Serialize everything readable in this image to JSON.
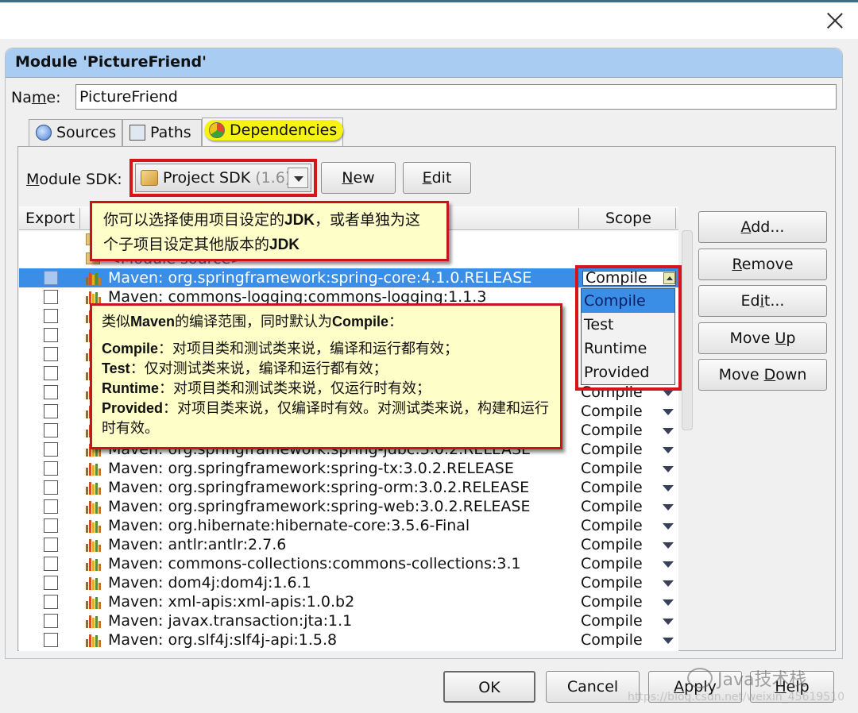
{
  "window": {
    "close_icon": "close-icon"
  },
  "panel": {
    "title": "Module 'PictureFriend'"
  },
  "name_field": {
    "label_pre": "Na",
    "label_u": "m",
    "label_post": "e:",
    "value": "PictureFriend"
  },
  "tabs": [
    {
      "label": "Sources",
      "icon": "sources-icon"
    },
    {
      "label": "Paths",
      "icon": "paths-icon"
    },
    {
      "label": "Dependencies",
      "icon": "dependencies-icon",
      "active": true
    }
  ],
  "sdk": {
    "label_u": "M",
    "label_rest": "odule SDK:",
    "selected": "Project SDK",
    "version": "(1.6)",
    "new_u": "N",
    "new_rest": "ew",
    "edit_u": "E",
    "edit_rest": "dit"
  },
  "table": {
    "headers": {
      "export": "Export",
      "scope": "Scope"
    },
    "rows": [
      {
        "type": "folder",
        "name": ""
      },
      {
        "type": "folder",
        "name": "<Module source>"
      },
      {
        "name": "Maven: org.springframework:spring-core:4.1.0.RELEASE",
        "scope": "Compile",
        "selected": true
      },
      {
        "name": "Maven: commons-logging:commons-logging:1.1.3",
        "scope": ""
      },
      {
        "name": "",
        "scope": ""
      },
      {
        "name": "",
        "scope": ""
      },
      {
        "name": "",
        "scope": ""
      },
      {
        "name": "",
        "scope": ""
      },
      {
        "name": "",
        "scope": "Compile"
      },
      {
        "name": "",
        "scope": "Compile"
      },
      {
        "name": "",
        "scope": "Compile"
      },
      {
        "name": "Maven: org.springframework:spring-jdbc:3.0.2.RELEASE",
        "scope": "Compile"
      },
      {
        "name": "Maven: org.springframework:spring-tx:3.0.2.RELEASE",
        "scope": "Compile"
      },
      {
        "name": "Maven: org.springframework:spring-orm:3.0.2.RELEASE",
        "scope": "Compile"
      },
      {
        "name": "Maven: org.springframework:spring-web:3.0.2.RELEASE",
        "scope": "Compile"
      },
      {
        "name": "Maven: org.hibernate:hibernate-core:3.5.6-Final",
        "scope": "Compile"
      },
      {
        "name": "Maven: antlr:antlr:2.7.6",
        "scope": "Compile"
      },
      {
        "name": "Maven: commons-collections:commons-collections:3.1",
        "scope": "Compile"
      },
      {
        "name": "Maven: dom4j:dom4j:1.6.1",
        "scope": "Compile"
      },
      {
        "name": "Maven: xml-apis:xml-apis:1.0.b2",
        "scope": "Compile"
      },
      {
        "name": "Maven: javax.transaction:jta:1.1",
        "scope": "Compile"
      },
      {
        "name": "Maven: org.slf4j:slf4j-api:1.5.8",
        "scope": "Compile"
      }
    ]
  },
  "scope_editor": {
    "value": "Compile",
    "options": [
      "Compile",
      "Test",
      "Runtime",
      "Provided"
    ],
    "highlighted": "Compile"
  },
  "side_buttons": {
    "add": {
      "u": "A",
      "rest": "dd..."
    },
    "remove": {
      "u": "R",
      "rest": "emove"
    },
    "edit": {
      "pre": "Ed",
      "u": "i",
      "rest": "t..."
    },
    "move_up": {
      "pre": "Move ",
      "u": "U",
      "rest": "p"
    },
    "move_down": {
      "pre": "Move ",
      "u": "D",
      "rest": "own"
    }
  },
  "callouts": {
    "sdk_pre": "你可以选择使用项目设定的",
    "sdk_jdk1": "JDK",
    "sdk_mid": "，或者单独为这个子项目设定其他版本的",
    "sdk_jdk2": "JDK",
    "scope_intro_pre": "类似",
    "scope_intro_maven": "Maven",
    "scope_intro_mid": "的编译范围，同时默认为",
    "scope_intro_compile": "Compile",
    "scope_intro_post": "：",
    "lines": [
      {
        "key": "Compile",
        "text": "：对项目类和测试类来说，编译和运行都有效；"
      },
      {
        "key": "Test",
        "text": "：仅对测试类来说，编译和运行都有效；"
      },
      {
        "key": "Runtime",
        "text": "：对项目类和测试类来说，仅运行时有效；"
      },
      {
        "key": "Provided",
        "text": "：对项目类来说，仅编译时有效。对测试类来说，构建和运行时有效。"
      }
    ]
  },
  "bottom_buttons": {
    "ok": "OK",
    "cancel": "Cancel",
    "apply_u": "A",
    "apply_rest": "pply",
    "help_u": "H",
    "help_rest": "elp"
  },
  "watermark": {
    "text": "Java技术栈",
    "url_text": "https://blog.csdn.net/weixin_45619510"
  }
}
